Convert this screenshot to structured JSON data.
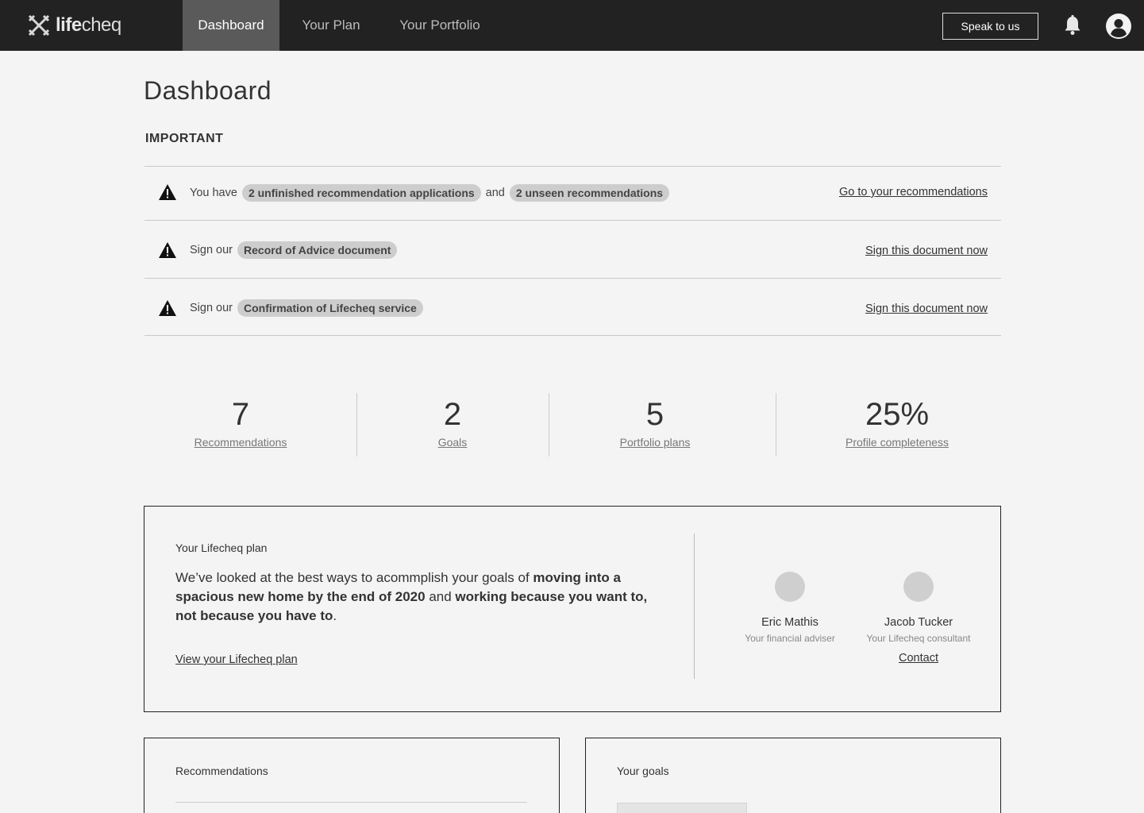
{
  "nav": {
    "logo": {
      "bold": "life",
      "regular": "cheq"
    },
    "tabs": [
      {
        "label": "Dashboard",
        "active": true
      },
      {
        "label": "Your Plan",
        "active": false
      },
      {
        "label": "Your Portfolio",
        "active": false
      }
    ],
    "speak_label": "Speak to us",
    "icons": {
      "notifications": "bell-icon",
      "account": "user-circle-icon"
    }
  },
  "page": {
    "title": "Dashboard",
    "section_label": "IMPORTANT"
  },
  "alerts": [
    {
      "prefix": "You have",
      "pill1": "2 unfinished recommendation applications",
      "joiner": "and",
      "pill2": "2 unseen recommendations",
      "link": "Go to your recommendations"
    },
    {
      "prefix": "Sign our",
      "pill1": "Record of Advice document",
      "link": "Sign this document now"
    },
    {
      "prefix": "Sign our",
      "pill1": "Confirmation of Lifecheq service",
      "link": "Sign this document now"
    }
  ],
  "stats": [
    {
      "value": "7",
      "label": "Recommendations"
    },
    {
      "value": "2",
      "label": "Goals"
    },
    {
      "value": "5",
      "label": "Portfolio plans"
    },
    {
      "value": "25%",
      "label": "Profile completeness"
    }
  ],
  "plan": {
    "heading": "Your Lifecheq plan",
    "text_1": "We’ve looked at the best ways to acommplish your goals of ",
    "bold_1": "moving into a spacious new home by the end of 2020",
    "text_2": " and ",
    "bold_2": "working because you want to, not because you have to",
    "text_3": ".",
    "link": "View your Lifecheq plan",
    "people": [
      {
        "name": "Eric Mathis",
        "role": "Your financial adviser"
      },
      {
        "name": "Jacob Tucker",
        "role": "Your Lifecheq consultant",
        "contact": "Contact"
      }
    ]
  },
  "cards": {
    "recommendations_title": "Recommendations",
    "goals_title": "Your goals"
  },
  "colors": {
    "nav_bg": "#222222",
    "nav_active": "#5a5a5a",
    "page_bg": "#f4f4f4",
    "pill_bg": "#cdcdcd"
  }
}
